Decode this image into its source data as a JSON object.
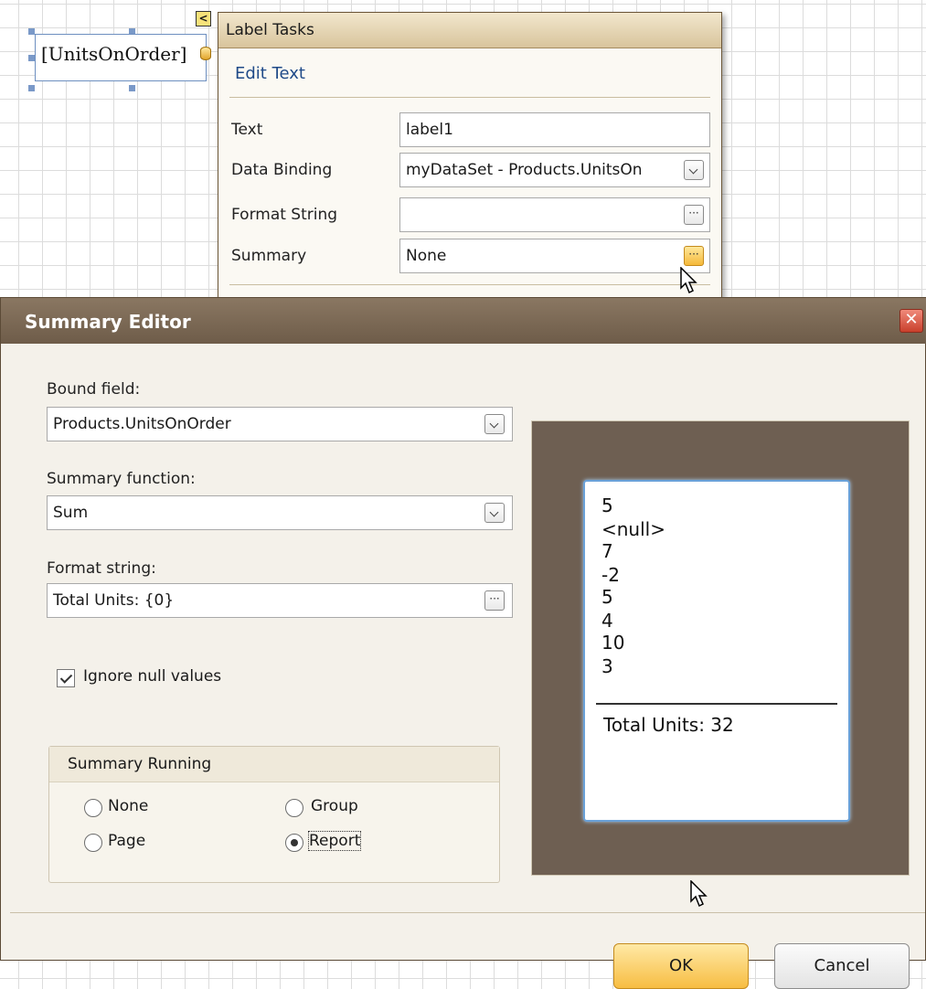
{
  "designer": {
    "label_text": "[UnitsOnOrder]",
    "smart_tag_glyph": "<"
  },
  "tasks_panel": {
    "title": "Label Tasks",
    "edit_text_link": "Edit Text",
    "rows": [
      {
        "label": "Text",
        "value": "label1"
      },
      {
        "label": "Data Binding",
        "value": "myDataSet - Products.UnitsOn"
      },
      {
        "label": "Format String",
        "value": ""
      },
      {
        "label": "Summary",
        "value": "None"
      }
    ],
    "ellipsis_glyph": "···"
  },
  "dialog": {
    "title": "Summary Editor",
    "close_glyph": "✕",
    "bound_field": {
      "label": "Bound field:",
      "value": "Products.UnitsOnOrder"
    },
    "summary_function": {
      "label": "Summary function:",
      "value": "Sum"
    },
    "format_string": {
      "label": "Format string:",
      "value": "Total Units: {0}"
    },
    "ignore_null": {
      "label": "Ignore null values",
      "checked": true
    },
    "summary_running": {
      "title": "Summary Running",
      "options": [
        "None",
        "Group",
        "Page",
        "Report"
      ],
      "selected": "Report"
    },
    "preview": {
      "values": [
        "5",
        "<null>",
        "7",
        "-2",
        "5",
        "4",
        "10",
        "3"
      ],
      "total": "Total Units: 32"
    },
    "ok_label": "OK",
    "cancel_label": "Cancel"
  },
  "colors": {
    "title_bar": "#7e6b57",
    "accent_button": "#f7bd42",
    "preview_bg": "#6e5f52",
    "selection_border": "#6d8fc0"
  }
}
